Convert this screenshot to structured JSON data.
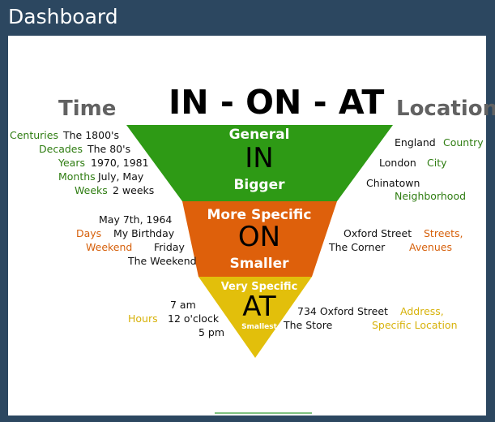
{
  "window": {
    "title": "Dashboard"
  },
  "diagram": {
    "title": "IN - ON - AT",
    "left_heading": "Time",
    "right_heading": "Location",
    "levels": {
      "in": {
        "top": "General",
        "word": "IN",
        "bottom": "Bigger",
        "color": "#2e9a15"
      },
      "on": {
        "top": "More Specific",
        "word": "ON",
        "bottom": "Smaller",
        "color": "#de600b"
      },
      "at": {
        "top": "Very Specific",
        "word": "AT",
        "bottom": "Smallest",
        "color": "#e2bf0b"
      }
    },
    "time_in": {
      "r1": {
        "cat": "Centuries",
        "ex": "The 1800's"
      },
      "r2": {
        "cat": "Decades",
        "ex": "The 80's"
      },
      "r3": {
        "cat": "Years",
        "ex": "1970, 1981"
      },
      "r4": {
        "cat": "Months",
        "ex": "July, May"
      },
      "r5": {
        "cat": "Weeks",
        "ex": "2 weeks"
      }
    },
    "time_on": {
      "ex1": "May 7th, 1964",
      "cat1": "Days",
      "ex2": "My Birthday",
      "cat2": "Weekend",
      "ex3": "Friday",
      "ex4": "The Weekend"
    },
    "time_at": {
      "ex1": "7 am",
      "cat1": "Hours",
      "ex2": "12 o'clock",
      "ex3": "5 pm"
    },
    "loc_in": {
      "ex1": "England",
      "cat1": "Country",
      "ex2": "London",
      "cat2": "City",
      "ex3": "Chinatown",
      "cat3": "Neighborhood"
    },
    "loc_on": {
      "ex1": "Oxford Street",
      "cat1": "Streets,",
      "ex2": "The Corner",
      "cat2": "Avenues"
    },
    "loc_at": {
      "ex1": "734 Oxford Street",
      "cat1": "Address,",
      "ex2": "The Store",
      "cat2": "Specific Location"
    }
  }
}
